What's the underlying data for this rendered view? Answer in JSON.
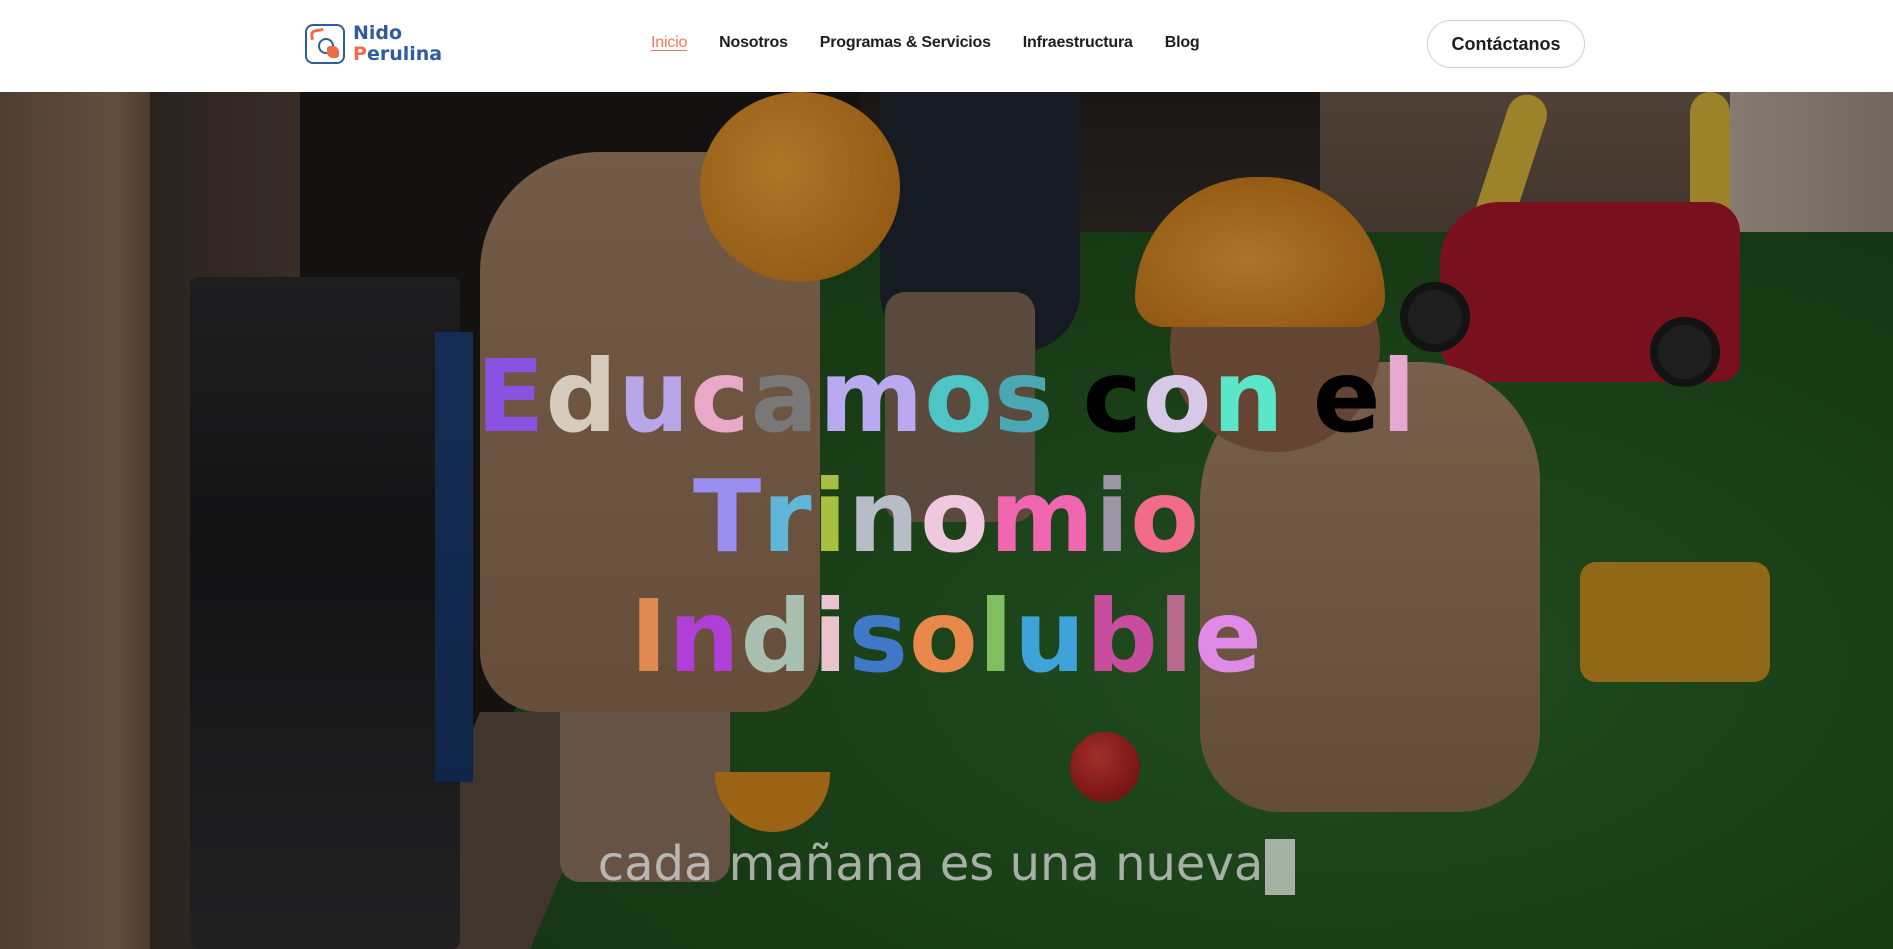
{
  "brand": {
    "line1": "Nido",
    "line2_first": "P",
    "line2_rest": "erulina",
    "color_primary": "#2f5d9a",
    "color_accent": "#ef6b4a"
  },
  "nav": {
    "items": [
      {
        "label": "Inicio",
        "active": true
      },
      {
        "label": "Nosotros",
        "active": false
      },
      {
        "label": "Programas & Servicios",
        "active": false
      },
      {
        "label": "Infraestructura",
        "active": false
      },
      {
        "label": "Blog",
        "active": false
      }
    ],
    "active_color": "#f07a57"
  },
  "cta": {
    "label": "Contáctanos"
  },
  "hero": {
    "headline_lines": [
      {
        "text": "Educamos con el",
        "colors": [
          "#8a52e0",
          "#d6cbbd",
          "#b8a7e8",
          "#eaa8c8",
          "#787878",
          "#b9a9f0",
          "#4ec4c4",
          "#4aa8b5",
          "#c48a6a",
          " ",
          "#d8c8e8",
          "#5ce6c9",
          "#47c2c0",
          " ",
          "#e6a8d0",
          "#eaa8c8",
          "#64c66a"
        ]
      },
      {
        "text": "Trinomio",
        "colors": [
          "#9a8ef0",
          "#5fb6d8",
          "#a7c042",
          "#b7bcc6",
          "#efc8e0",
          "#f067b0",
          "#9c96a8",
          "#f26b8a"
        ]
      },
      {
        "text": "Indisoluble",
        "colors": [
          "#e08a52",
          "#b03fd8",
          "#a9bfb0",
          "#e9c3cf",
          "#3f78c6",
          "#e8884a",
          "#7fbf62",
          "#3ea3d8",
          "#c84d9e",
          "#b86a8f",
          "#e08ae8"
        ]
      }
    ],
    "typed_text": "cada mañana es una nueva",
    "background_description_icon": "children-playing-photo"
  }
}
